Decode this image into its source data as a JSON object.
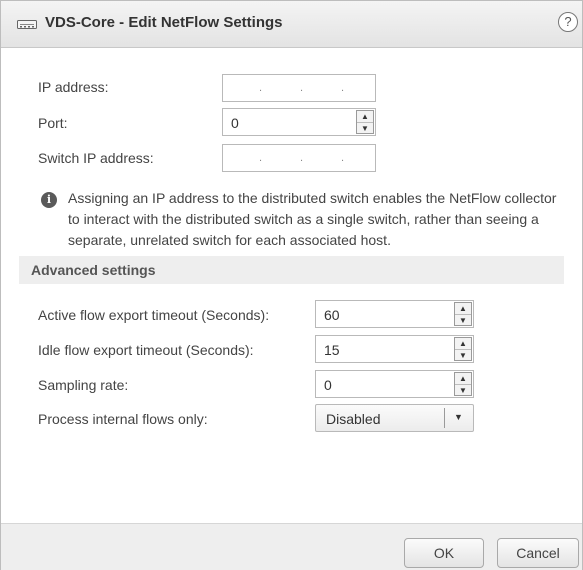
{
  "dialog": {
    "title": "VDS-Core - Edit NetFlow Settings",
    "help_glyph": "?",
    "title_icon": "switch-icon"
  },
  "form": {
    "ip_address_label": "IP address:",
    "ip_address_dots": [
      ".",
      ".",
      "."
    ],
    "port_label": "Port:",
    "port_value": "0",
    "switch_ip_label": "Switch IP address:",
    "switch_ip_dots": [
      ".",
      ".",
      "."
    ]
  },
  "info": {
    "icon": "info-icon",
    "glyph": "i",
    "text": "Assigning an IP address to the distributed switch enables the NetFlow collector to interact with the distributed switch as a single switch, rather than seeing a separate, unrelated switch for each associated host."
  },
  "advanced": {
    "title": "Advanced settings",
    "active_timeout_label": "Active flow export timeout (Seconds):",
    "active_timeout_value": "60",
    "idle_timeout_label": "Idle flow export timeout (Seconds):",
    "idle_timeout_value": "15",
    "sampling_rate_label": "Sampling rate:",
    "sampling_rate_value": "0",
    "internal_flows_label": "Process internal flows only:",
    "internal_flows_value": "Disabled"
  },
  "spinner": {
    "up": "▲",
    "down": "▼"
  },
  "select_arrow": "▼",
  "footer": {
    "ok_label": "OK",
    "cancel_label": "Cancel"
  }
}
